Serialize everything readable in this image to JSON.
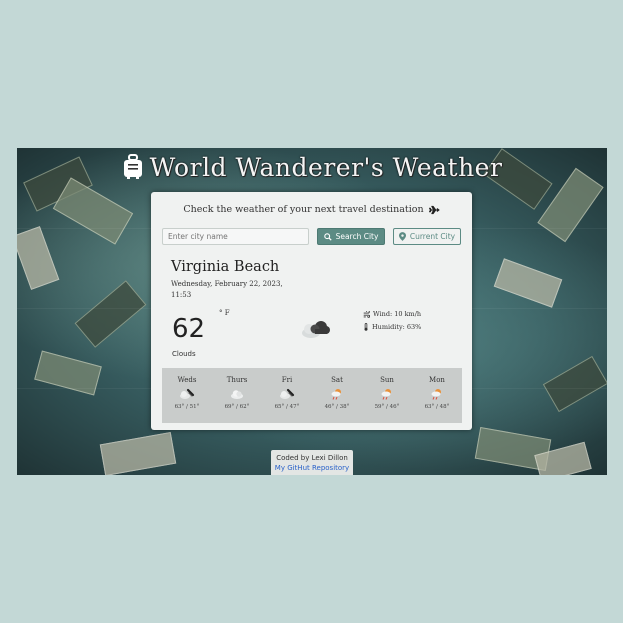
{
  "header": {
    "title": "World Wanderer's Weather",
    "icon": "luggage-icon"
  },
  "search": {
    "prompt": "Check the weather of your next travel destination",
    "prompt_icon": "airplane-icon",
    "placeholder": "Enter city name",
    "search_button_label": "Search City",
    "current_button_label": "Current City"
  },
  "current": {
    "city": "Virginia Beach",
    "date": "Wednesday, February 22, 2023, 11:53",
    "temperature": "62",
    "unit": "° F",
    "description": "Clouds",
    "wind": "Wind: 10 km/h",
    "humidity": "Humidity: 63%"
  },
  "forecast": [
    {
      "day": "Weds",
      "icon": "cloudy-windy-icon",
      "temps": "63° / 51°"
    },
    {
      "day": "Thurs",
      "icon": "clouds-icon",
      "temps": "69° / 62°"
    },
    {
      "day": "Fri",
      "icon": "cloudy-windy-icon",
      "temps": "65° / 47°"
    },
    {
      "day": "Sat",
      "icon": "sun-rain-icon",
      "temps": "46° / 38°"
    },
    {
      "day": "Sun",
      "icon": "sun-rain-icon",
      "temps": "59° / 46°"
    },
    {
      "day": "Mon",
      "icon": "sun-rain-icon",
      "temps": "63° / 48°"
    }
  ],
  "footer": {
    "credit": "Coded by Lexi Dillon",
    "repo_link": "My GitHut Repository"
  },
  "colors": {
    "page_bg": "#c3d8d6",
    "accent": "#5c8b84",
    "card_bg": "#f0f2f1",
    "link": "#2a62c9"
  }
}
